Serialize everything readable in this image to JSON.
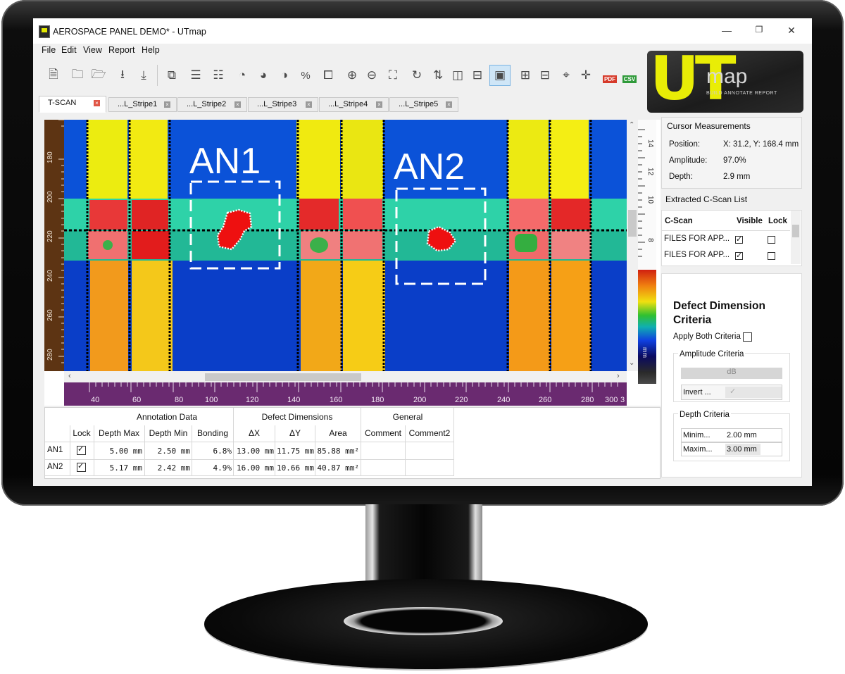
{
  "window": {
    "title": "AEROSPACE PANEL DEMO* - UTmap",
    "minimize": "—",
    "maximize": "❐",
    "close": "✕"
  },
  "menu": [
    "File",
    "Edit",
    "View",
    "Report",
    "Help"
  ],
  "toolbar_icons": [
    "open-scan-icon",
    "open-folder-icon",
    "open-recent-icon",
    "import-icon",
    "import-multiple-icon",
    "extract-icon",
    "stripe-add-icon",
    "stripe-remove-icon",
    "palette-icon",
    "palette-edit-icon",
    "palette-settings-icon",
    "percent-icon",
    "crop-icon",
    "zoom-in-icon",
    "zoom-out-icon",
    "fit-view-icon",
    "rotate-icon",
    "flip-icon",
    "mirror-horizontal-icon",
    "mirror-vertical-icon",
    "view-settings-icon",
    "add-annotation-icon",
    "remove-annotation-icon",
    "add-measure-icon",
    "remove-measure-icon",
    "export-pdf-icon",
    "export-csv-icon"
  ],
  "logo": {
    "letters": "UT",
    "word": "map",
    "tagline": "BUILD ANNOTATE REPORT"
  },
  "tabs": [
    {
      "label": "T-SCAN",
      "active": true
    },
    {
      "label": "...L_Stripe1",
      "active": false
    },
    {
      "label": "...L_Stripe2",
      "active": false
    },
    {
      "label": "...L_Stripe3",
      "active": false
    },
    {
      "label": "...L_Stripe4",
      "active": false
    },
    {
      "label": "...L_Stripe5",
      "active": false
    }
  ],
  "scan": {
    "annotations": [
      {
        "label": "AN1"
      },
      {
        "label": "AN2"
      }
    ],
    "y_ticks": [
      "180",
      "200",
      "220",
      "240",
      "260",
      "280"
    ],
    "x_ticks": [
      "40",
      "60",
      "80",
      "100",
      "120",
      "140",
      "160",
      "180",
      "200",
      "220",
      "240",
      "260",
      "280",
      "300",
      "3"
    ],
    "right_ticks": [
      "14",
      "12",
      "10",
      "8"
    ],
    "right_unit": "mm"
  },
  "cursor_measurements": {
    "title": "Cursor Measurements",
    "rows": [
      {
        "label": "Position:",
        "value": "X: 31.2, Y: 168.4 mm"
      },
      {
        "label": "Amplitude:",
        "value": "97.0%"
      },
      {
        "label": "Depth:",
        "value": "2.9 mm"
      }
    ]
  },
  "cscan_list": {
    "title": "Extracted C-Scan List",
    "headers": [
      "C-Scan",
      "Visible",
      "Lock"
    ],
    "rows": [
      {
        "name": "FILES FOR APP...",
        "visible": true,
        "lock": false
      },
      {
        "name": "FILES FOR APP...",
        "visible": true,
        "lock": false
      }
    ]
  },
  "criteria": {
    "title": "Defect Dimension Criteria",
    "apply_both": "Apply Both Criteria",
    "amplitude_title": "Amplitude Criteria",
    "amplitude_unit": "dB",
    "invert_label": "Invert ...",
    "depth_title": "Depth Criteria",
    "depth_rows": [
      {
        "label": "Minim...",
        "value": "2.00 mm"
      },
      {
        "label": "Maxim...",
        "value": "3.00 mm"
      }
    ]
  },
  "annotation_table": {
    "groups": [
      "Annotation Data",
      "Defect Dimensions",
      "General"
    ],
    "headers": [
      "Lock",
      "Depth Max",
      "Depth Min",
      "Bonding",
      "ΔX",
      "ΔY",
      "Area",
      "Comment",
      "Comment2"
    ],
    "rows": [
      {
        "name": "AN1",
        "lock": true,
        "depth_max": "5.00 mm",
        "depth_min": "2.50 mm",
        "bonding": "6.8%",
        "dx": "13.00 mm",
        "dy": "11.75 mm",
        "area": "85.88 mm²",
        "comment": "",
        "comment2": ""
      },
      {
        "name": "AN2",
        "lock": true,
        "depth_max": "5.17 mm",
        "depth_min": "2.42 mm",
        "bonding": "4.9%",
        "dx": "16.00 mm",
        "dy": "10.66 mm",
        "area": "40.87 mm²",
        "comment": "",
        "comment2": ""
      }
    ]
  }
}
